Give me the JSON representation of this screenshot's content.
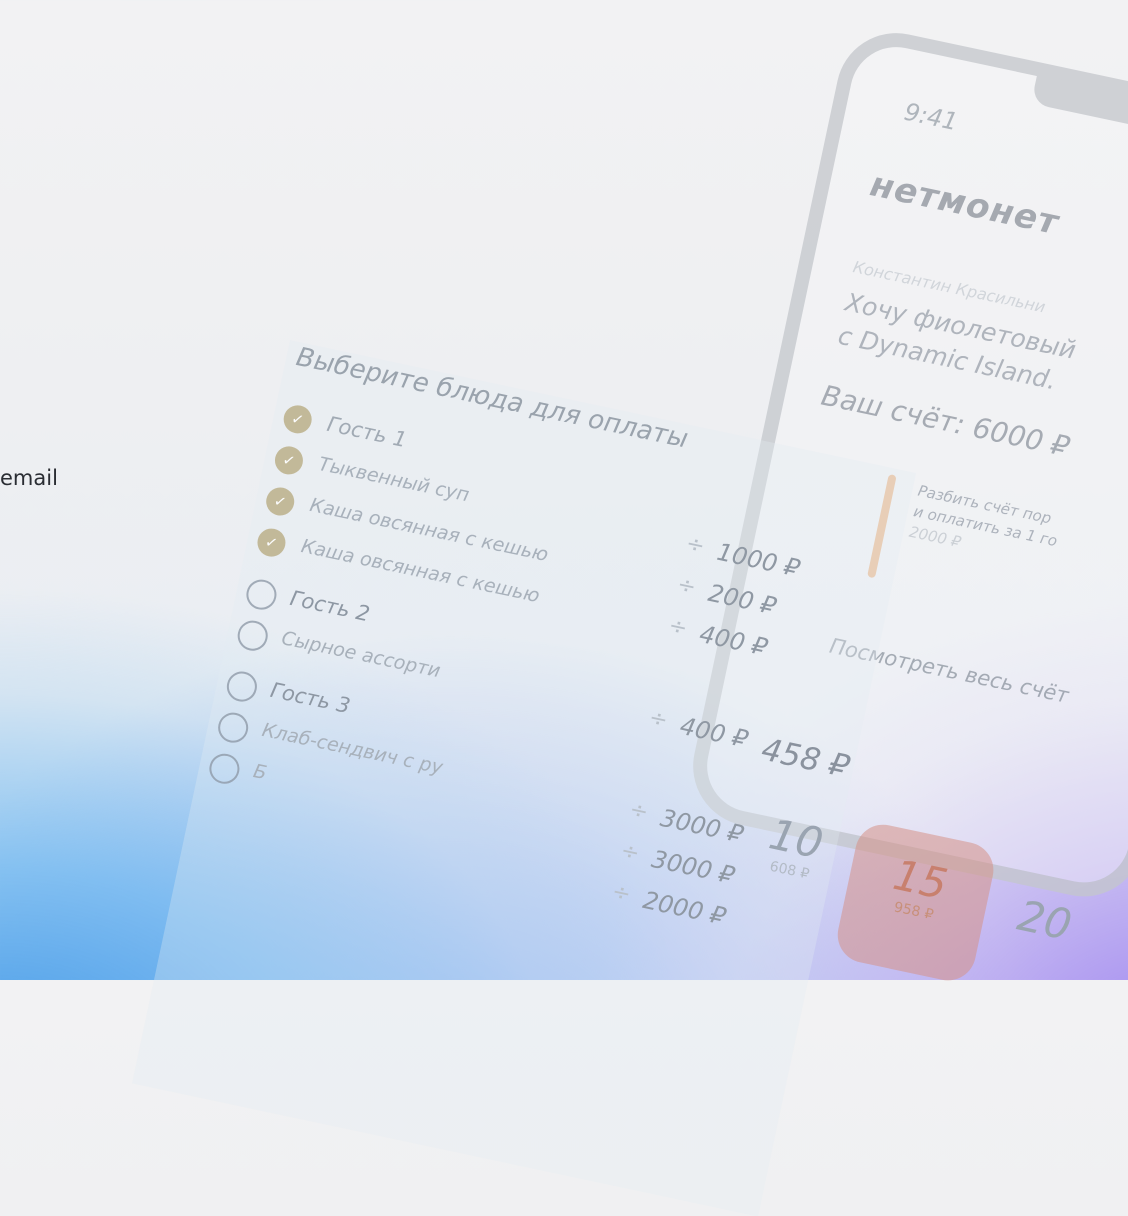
{
  "background": {
    "left_fragment": "email",
    "colors": {
      "blue": "#3a94e6",
      "violet": "#9678f0",
      "accent_orange": "#e9a66a",
      "selected_tip": "#d69286"
    }
  },
  "phone": {
    "time": "9:41",
    "brand": "нетмонет",
    "author": "Константин Красильни",
    "quote_line1": "Хочу фиолетовый",
    "quote_line2": "с Dynamic Island.",
    "bill": "Ваш счёт: 6000 ₽",
    "split_line1": "Разбить счёт пор",
    "split_line2": "и оплатить за 1 го",
    "split_amount": "2000 ₽",
    "view_bill": "Посмотреть весь счёт"
  },
  "menu": {
    "title": "Выберите блюда для оплаты",
    "guests": [
      {
        "label": "Гость 1",
        "checked": true,
        "items": [
          {
            "label": "Тыквенный суп",
            "price": "1000 ₽",
            "checked": true
          },
          {
            "label": "Каша овсянная с кешью",
            "price": "200 ₽",
            "checked": true
          },
          {
            "label": "Каша овсянная с кешью",
            "price": "400 ₽",
            "checked": true
          }
        ]
      },
      {
        "label": "Гость 2",
        "checked": false,
        "items": [
          {
            "label": "Сырное ассорти",
            "price": "400 ₽",
            "checked": false
          }
        ]
      },
      {
        "label": "Гость 3",
        "checked": false,
        "items": [
          {
            "label": "Клаб-сендвич с ру",
            "price": "3000 ₽",
            "checked": false
          },
          {
            "label": "Б",
            "price": "3000 ₽",
            "checked": false
          }
        ]
      }
    ],
    "extra_price": "2000 ₽",
    "divide_icon": "÷"
  },
  "tips": {
    "amount": "458 ₽",
    "options": [
      {
        "value": "10",
        "sub": "608 ₽",
        "selected": false
      },
      {
        "value": "15",
        "sub": "958 ₽",
        "selected": true
      },
      {
        "value": "20",
        "sub": "",
        "selected": false
      }
    ]
  }
}
